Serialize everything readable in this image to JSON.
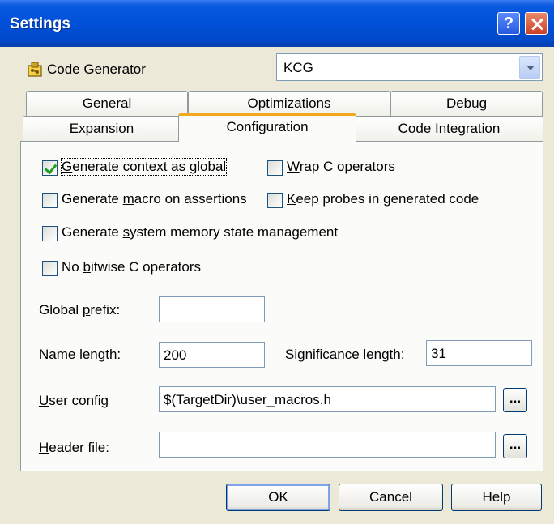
{
  "window": {
    "title": "Settings",
    "help_glyph": "?"
  },
  "generator": {
    "label": "Code Generator",
    "value": "KCG"
  },
  "tabs": {
    "row1": [
      "General",
      "Optimizations",
      "Debug"
    ],
    "row2": [
      "Expansion",
      "Configuration",
      "Code Integration"
    ],
    "active": "Configuration"
  },
  "options": {
    "generate_context_global": {
      "pre": "",
      "key": "G",
      "post": "enerate context as global",
      "checked": true
    },
    "wrap_c_operators": {
      "pre": "",
      "key": "W",
      "post": "rap C operators",
      "checked": false
    },
    "generate_macro_assertions": {
      "pre": "Generate ",
      "key": "m",
      "post": "acro on assertions",
      "checked": false
    },
    "keep_probes": {
      "pre": "",
      "key": "K",
      "post": "eep probes in generated code",
      "checked": false
    },
    "system_memory_state": {
      "pre": "Generate ",
      "key": "s",
      "post": "ystem memory state management",
      "checked": false
    },
    "no_bitwise": {
      "pre": "No ",
      "key": "b",
      "post": "itwise C operators",
      "checked": false
    }
  },
  "fields": {
    "global_prefix": {
      "pre": "Global ",
      "key": "p",
      "post": "refix:",
      "value": ""
    },
    "name_length": {
      "pre": "",
      "key": "N",
      "post": "ame length:",
      "value": "200"
    },
    "significance_length": {
      "pre": "",
      "key": "S",
      "post": "ignificance length:",
      "value": "31"
    },
    "user_config": {
      "pre": "",
      "key": "U",
      "post": "ser config",
      "value": "$(TargetDir)\\user_macros.h"
    },
    "header_file": {
      "pre": "",
      "key": "H",
      "post": "eader file:",
      "value": ""
    }
  },
  "browse_label": "...",
  "buttons": {
    "ok": "OK",
    "cancel": "Cancel",
    "help": "Help"
  },
  "colors": {
    "titlebar": "#0050d8",
    "active_tab_accent": "#f1a91c",
    "dialog_bg": "#ece9d8",
    "check_mark": "#21a121"
  }
}
